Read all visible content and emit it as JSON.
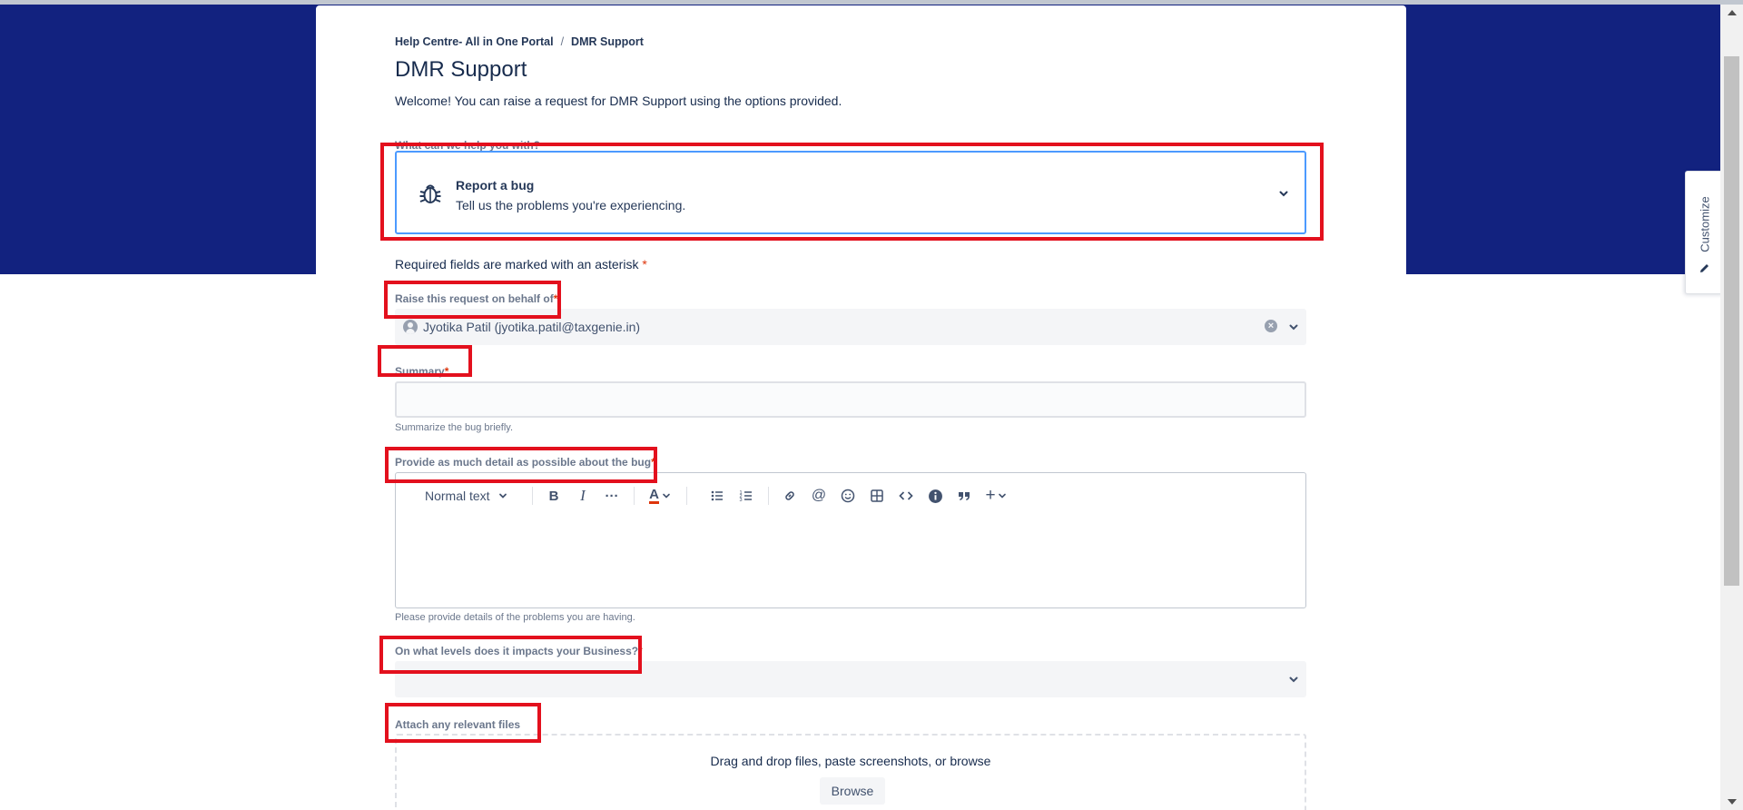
{
  "breadcrumb": {
    "portal": "Help Centre- All in One Portal",
    "separator": "/",
    "current": "DMR Support"
  },
  "page": {
    "title": "DMR Support",
    "welcome": "Welcome! You can raise a request for DMR Support using the options provided."
  },
  "request_type": {
    "question": "What can we help you with?",
    "title": "Report a bug",
    "description": "Tell us the problems you're experiencing.",
    "icon": "bug-icon"
  },
  "required_note": {
    "text": "Required fields are marked with an asterisk",
    "asterisk": "*"
  },
  "fields": {
    "on_behalf": {
      "label": "Raise this request on behalf of",
      "value": "Jyotika Patil (jyotika.patil@taxgenie.in)"
    },
    "summary": {
      "label": "Summary",
      "value": "",
      "helper": "Summarize the bug briefly."
    },
    "details": {
      "label": "Provide as much detail as possible about the bug",
      "helper": "Please provide details of the problems you are having."
    },
    "impact": {
      "label": "On what levels does it impacts your Business?",
      "value": ""
    },
    "attach": {
      "label": "Attach any relevant files",
      "drop_text": "Drag and drop files, paste screenshots, or browse",
      "browse": "Browse"
    }
  },
  "editor_toolbar": {
    "text_style": "Normal text",
    "bold": "B",
    "italic": "I",
    "more": "···",
    "text_color": "A",
    "insert": "+"
  },
  "customize": {
    "label": "Customize"
  },
  "colors": {
    "banner": "#12227f",
    "highlight": "#e3101d",
    "focus": "#4c9aff",
    "required": "#de350b"
  }
}
